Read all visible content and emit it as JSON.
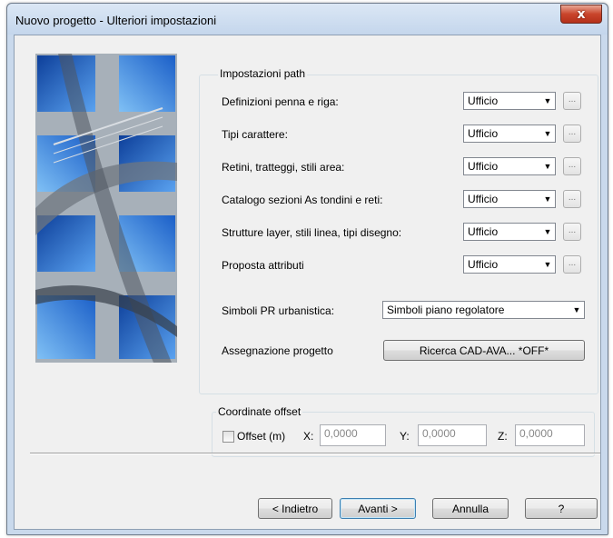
{
  "window": {
    "title": "Nuovo progetto - Ulteriori impostazioni",
    "close_glyph": "x"
  },
  "path_group": {
    "title": "Impostazioni path",
    "rows": [
      {
        "label": "Definizioni penna e riga:",
        "value": "Ufficio",
        "more": "..."
      },
      {
        "label": "Tipi carattere:",
        "value": "Ufficio",
        "more": "..."
      },
      {
        "label": "Retini, tratteggi, stili area:",
        "value": "Ufficio",
        "more": "..."
      },
      {
        "label": "Catalogo sezioni As tondini e reti:",
        "value": "Ufficio",
        "more": "..."
      },
      {
        "label": "Strutture layer, stili linea, tipi disegno:",
        "value": "Ufficio",
        "more": "..."
      },
      {
        "label": "Proposta attributi",
        "value": "Ufficio",
        "more": "..."
      }
    ],
    "simboli_label": "Simboli PR urbanistica:",
    "simboli_value": "Simboli piano regolatore",
    "assegnazione_label": "Assegnazione progetto",
    "assegnazione_button": "Ricerca CAD-AVA... *OFF*"
  },
  "offset_group": {
    "title": "Coordinate offset",
    "checkbox_label": "Offset (m)",
    "x_label": "X:",
    "x_value": "0,0000",
    "y_label": "Y:",
    "y_value": "0,0000",
    "z_label": "Z:",
    "z_value": "0,0000"
  },
  "buttons": {
    "back": "< Indietro",
    "next": "Avanti >",
    "cancel": "Annulla",
    "help": "?"
  },
  "colors": {
    "accent": "#3c7fb1",
    "close": "#c9452b",
    "photo_blue": "#2a6fd0"
  }
}
